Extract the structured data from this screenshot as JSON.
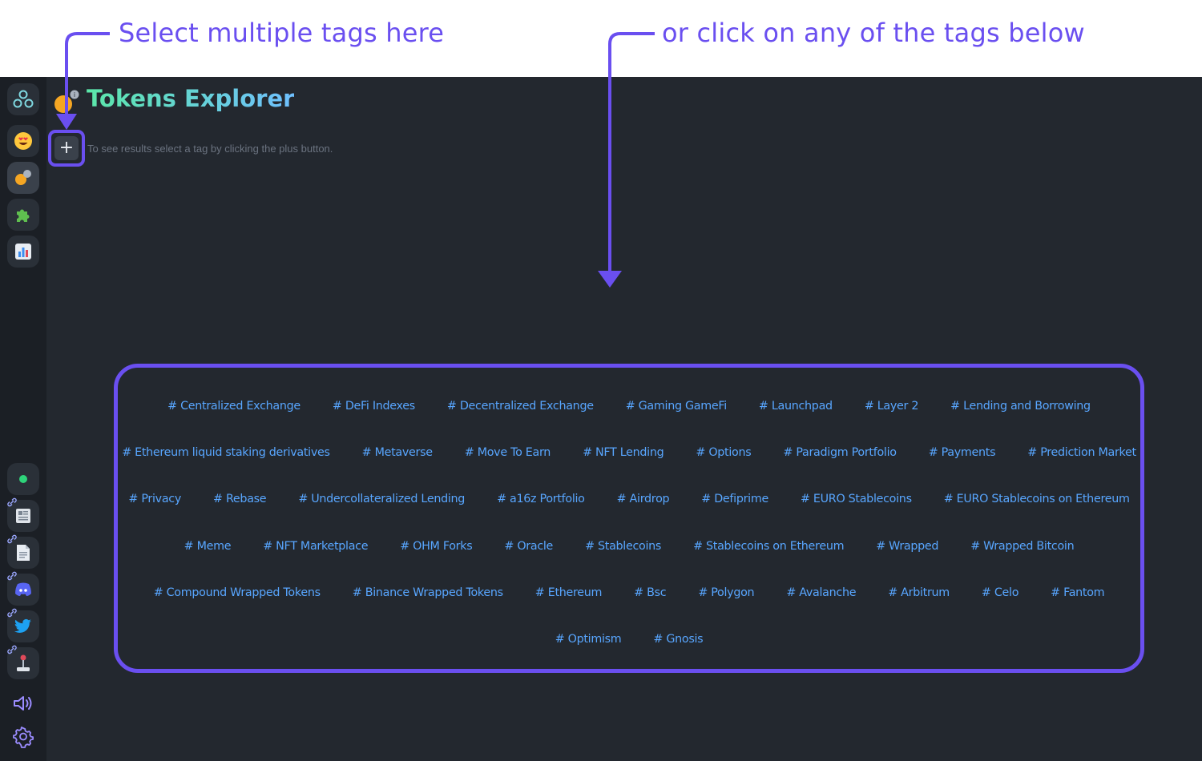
{
  "annotations": {
    "left_callout": "Select multiple tags here",
    "right_callout": "or click on any of the tags below"
  },
  "page": {
    "title": "Tokens Explorer",
    "hint": "To see results select a tag by clicking the plus button.",
    "add_button": "+"
  },
  "sidebar": {
    "top_items": [
      {
        "icon": "app-logo-icon"
      },
      {
        "icon": "heart-eyes-emoji-icon"
      },
      {
        "icon": "tokens-explorer-icon"
      },
      {
        "icon": "puzzle-icon"
      },
      {
        "icon": "bar-chart-icon"
      }
    ],
    "bottom_items": [
      {
        "icon": "status-dot-icon"
      },
      {
        "icon": "newspaper-icon"
      },
      {
        "icon": "document-icon"
      },
      {
        "icon": "discord-icon"
      },
      {
        "icon": "twitter-icon"
      },
      {
        "icon": "joystick-icon"
      },
      {
        "icon": "speaker-icon"
      },
      {
        "icon": "gear-icon"
      }
    ]
  },
  "colors": {
    "accent": "#6a4ff0",
    "tag": "#58a6ff",
    "background": "#23282f",
    "sidebar": "#1b1f25"
  },
  "tags": [
    [
      "# Centralized Exchange",
      "# DeFi Indexes",
      "# Decentralized Exchange",
      "# Gaming GameFi",
      "# Launchpad",
      "# Layer 2",
      "# Lending and Borrowing"
    ],
    [
      "# Ethereum liquid staking derivatives",
      "# Metaverse",
      "# Move To Earn",
      "# NFT Lending",
      "# Options",
      "# Paradigm Portfolio",
      "# Payments",
      "# Prediction Market"
    ],
    [
      "# Privacy",
      "# Rebase",
      "# Undercollateralized Lending",
      "# a16z Portfolio",
      "# Airdrop",
      "# Defiprime",
      "# EURO Stablecoins",
      "# EURO Stablecoins on Ethereum"
    ],
    [
      "# Meme",
      "# NFT Marketplace",
      "# OHM Forks",
      "# Oracle",
      "# Stablecoins",
      "# Stablecoins on Ethereum",
      "# Wrapped",
      "# Wrapped Bitcoin"
    ],
    [
      "# Compound Wrapped Tokens",
      "# Binance Wrapped Tokens",
      "# Ethereum",
      "# Bsc",
      "# Polygon",
      "# Avalanche",
      "# Arbitrum",
      "# Celo",
      "# Fantom"
    ],
    [
      "# Optimism",
      "# Gnosis"
    ]
  ]
}
